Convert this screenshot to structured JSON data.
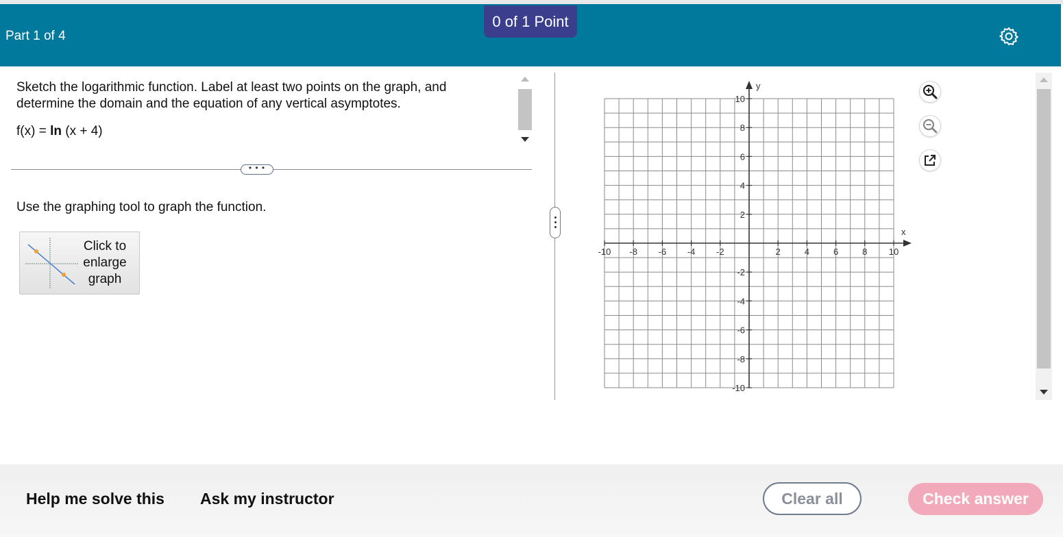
{
  "header": {
    "part_label": "Part 1 of 4",
    "points": "0 of 1 Point",
    "settings_icon": "gear-icon",
    "color": "#00799c",
    "badge_color": "#3a3e8c"
  },
  "question": {
    "prompt": "Sketch the logarithmic function. Label at least two points on the graph, and determine the domain and the equation of any vertical asymptotes.",
    "formula_prefix": "f(x) = ",
    "formula_fn": "ln",
    "formula_arg": " (x + 4)",
    "expand_label": "• • •",
    "instruction": "Use the graphing tool to graph the function.",
    "enlarge_label": "Click to enlarge graph"
  },
  "graph": {
    "x_label": "x",
    "y_label": "y",
    "x_range": [
      -10,
      10
    ],
    "y_range": [
      -10,
      10
    ],
    "grid_step": 1,
    "x_ticks": [
      "-10",
      "-8",
      "-6",
      "-4",
      "-2",
      "2",
      "4",
      "6",
      "8",
      "10"
    ],
    "y_ticks": [
      "10",
      "8",
      "6",
      "4",
      "2",
      "-2",
      "-4",
      "-6",
      "-8",
      "-10"
    ]
  },
  "tools": {
    "zoom_in_icon": "zoom-in-icon",
    "zoom_out_icon": "zoom-out-icon",
    "popout_icon": "external-link-icon"
  },
  "footer": {
    "help": "Help me solve this",
    "ask": "Ask my instructor",
    "clear": "Clear all",
    "check": "Check answer",
    "check_color": "#f2a9b9"
  }
}
